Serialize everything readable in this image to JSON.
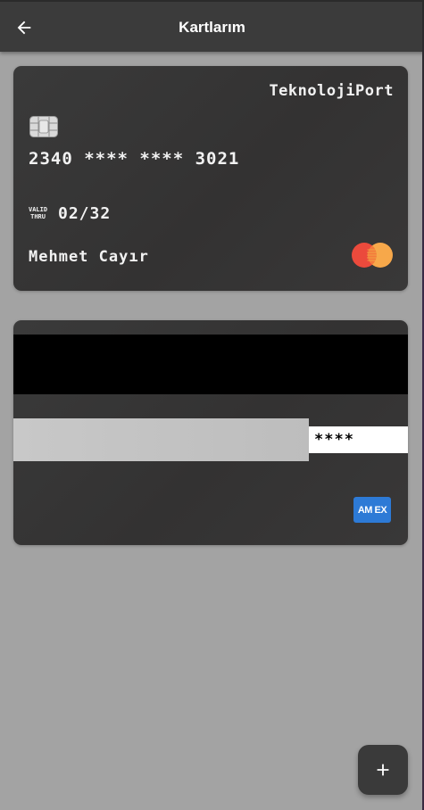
{
  "appbar": {
    "title": "Kartlarım",
    "back_icon": "arrow-left-icon"
  },
  "card_front": {
    "brand": "TeknolojiPort",
    "chip_icon": "card-chip-icon",
    "number": "2340 **** **** 3021",
    "valid_thru_line1": "VALID",
    "valid_thru_line2": "THRU",
    "expiry": "02/32",
    "holder": "Mehmet Cayır",
    "network_icon": "mastercard-logo",
    "colors": {
      "mc_red": "#eb4a3c",
      "mc_orange": "#f7a84a"
    }
  },
  "card_back": {
    "cvv": "****",
    "network_label": "AM EX",
    "network_color": "#2d7ad6"
  },
  "fab": {
    "icon": "plus-icon"
  }
}
